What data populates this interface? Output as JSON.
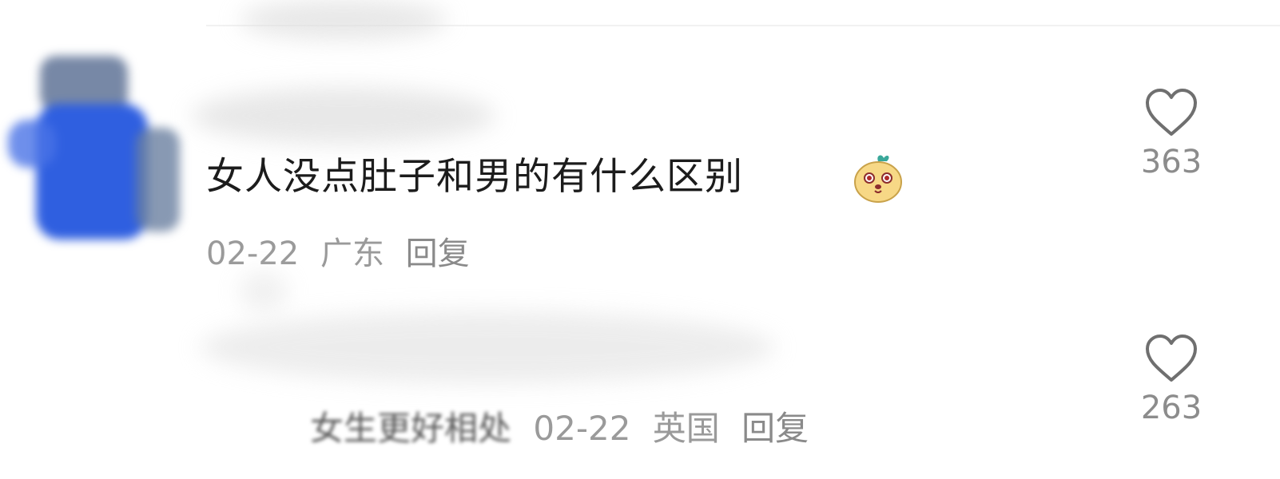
{
  "comments": [
    {
      "text": "女人没点肚子和男的有什么区别",
      "emoji_icon": "bean-emoji-icon",
      "date": "02-22",
      "location": "广东",
      "reply_label": "回复",
      "likes": "363"
    }
  ],
  "replies": [
    {
      "text": "女生更好相处",
      "date": "02-22",
      "location": "英国",
      "reply_label": "回复",
      "likes": "263"
    }
  ],
  "icons": {
    "like": "heart-outline-icon"
  },
  "colors": {
    "text_primary": "#1c1c1c",
    "text_meta": "#9a9a9a",
    "icon": "#6f6f6f"
  }
}
